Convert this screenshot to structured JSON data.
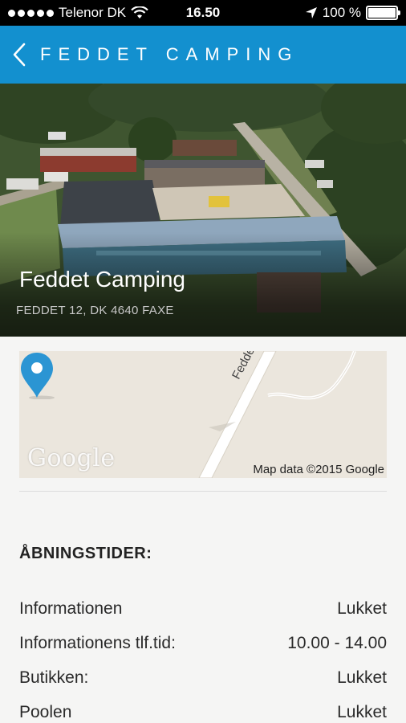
{
  "status_bar": {
    "carrier": "Telenor DK",
    "time": "16.50",
    "battery": "100 %",
    "battery_level_percent": 100
  },
  "nav": {
    "title": "FEDDET CAMPING",
    "back_icon": "chevron-left-icon"
  },
  "hero": {
    "title": "Feddet Camping",
    "address": "FEDDET 12, DK 4640 FAXE"
  },
  "map": {
    "road_label": "Feddet",
    "logo": "Google",
    "attribution": "Map data ©2015 Google",
    "pin_color": "#2b95d3"
  },
  "hours": {
    "title": "ÅBNINGSTIDER:",
    "rows": [
      {
        "label": "Informationen",
        "value": "Lukket"
      },
      {
        "label": "Informationens tlf.tid:",
        "value": "10.00 - 14.00"
      },
      {
        "label": "Butikken:",
        "value": "Lukket"
      },
      {
        "label": "Poolen",
        "value": "Lukket"
      }
    ]
  },
  "colors": {
    "nav_background": "#1390cf",
    "status_background": "#000000"
  }
}
